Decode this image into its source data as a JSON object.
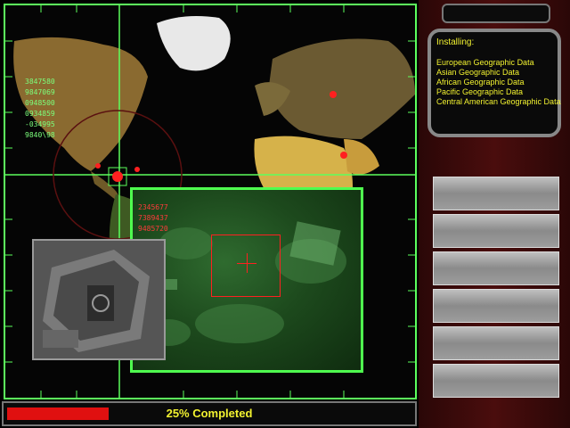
{
  "map": {
    "coords_green": [
      "3847580",
      "9847069",
      "0948500",
      "0934859",
      "-034995",
      "9840\\98"
    ],
    "coords_red": [
      "2345677",
      "7389437",
      "9485720"
    ]
  },
  "installer": {
    "header": "Installing:",
    "items": [
      "European Geographic Data",
      "Asian Geographic Data",
      "African Geographic Data",
      "Pacific Geographic Data",
      "Central American Geographic Data"
    ]
  },
  "progress": {
    "fraction": 0.25,
    "label": "25% Completed"
  },
  "colors": {
    "grid": "#5cff5c",
    "marker": "#ff2020",
    "text": "#f2f230"
  }
}
